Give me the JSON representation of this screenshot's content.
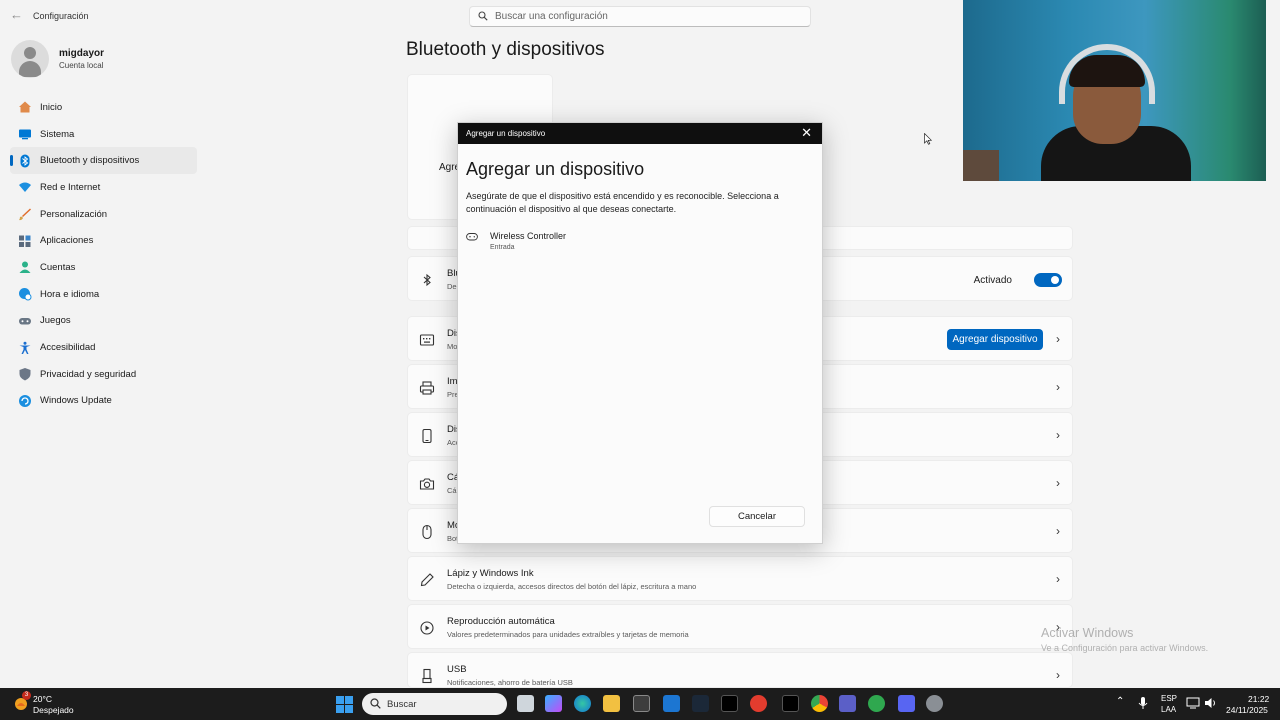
{
  "app": {
    "title": "Configuración",
    "search_placeholder": "Buscar una configuración"
  },
  "profile": {
    "name": "migdayor",
    "account_type": "Cuenta local"
  },
  "sidebar": {
    "items": [
      {
        "label": "Inicio",
        "icon": "home-icon",
        "color": "#d97a3a",
        "active": false
      },
      {
        "label": "Sistema",
        "icon": "system-icon",
        "color": "#0078d4",
        "active": false
      },
      {
        "label": "Bluetooth y dispositivos",
        "icon": "bluetooth-icon",
        "color": "#0078d4",
        "active": true
      },
      {
        "label": "Red e Internet",
        "icon": "wifi-icon",
        "color": "#1b8fe0",
        "active": false
      },
      {
        "label": "Personalización",
        "icon": "brush-icon",
        "color": "#e06c2b",
        "active": false
      },
      {
        "label": "Aplicaciones",
        "icon": "apps-icon",
        "color": "#5a6a7d",
        "active": false
      },
      {
        "label": "Cuentas",
        "icon": "account-icon",
        "color": "#2bb28a",
        "active": false
      },
      {
        "label": "Hora e idioma",
        "icon": "globe-clock-icon",
        "color": "#1b8fe0",
        "active": false
      },
      {
        "label": "Juegos",
        "icon": "gamepad-icon",
        "color": "#6a7785",
        "active": false
      },
      {
        "label": "Accesibilidad",
        "icon": "accessibility-icon",
        "color": "#1b6fd0",
        "active": false
      },
      {
        "label": "Privacidad y seguridad",
        "icon": "shield-icon",
        "color": "#6c7787",
        "active": false
      },
      {
        "label": "Windows Update",
        "icon": "update-icon",
        "color": "#1b8fe0",
        "active": false
      }
    ]
  },
  "main": {
    "page_title": "Bluetooth y dispositivos",
    "add_tile_label": "Agre",
    "rows": {
      "bluetooth": {
        "title": "Blu",
        "subtitle": "De",
        "toggle_label": "Activado",
        "toggle_on": true
      },
      "devices": {
        "title": "Dis",
        "subtitle": "Mo",
        "button_label": "Agregar dispositivo"
      },
      "printers": {
        "title": "Im",
        "subtitle": "Pre"
      },
      "phone": {
        "title": "Dis",
        "subtitle": "Acc"
      },
      "cameras": {
        "title": "Cá",
        "subtitle": "Cá"
      },
      "mouse": {
        "title": "Mo",
        "subtitle": "Bot"
      },
      "pen": {
        "title": "Lápiz y Windows Ink",
        "subtitle": "Detecha o izquierda, accesos directos del botón del lápiz, escritura a mano"
      },
      "autoplay": {
        "title": "Reproducción automática",
        "subtitle": "Valores predeterminados para unidades extraíbles y tarjetas de memoria"
      },
      "usb": {
        "title": "USB",
        "subtitle": "Notificaciones, ahorro de batería USB"
      }
    }
  },
  "dialog": {
    "window_title": "Agregar un dispositivo",
    "heading": "Agregar un dispositivo",
    "description": "Asegúrate de que el dispositivo está encendido y es reconocible. Selecciona a continuación el dispositivo al que deseas conectarte.",
    "devices": [
      {
        "name": "Wireless Controller",
        "type": "Entrada",
        "icon": "gamepad-icon"
      }
    ],
    "cancel_label": "Cancelar"
  },
  "watermark": {
    "line1": "Activar Windows",
    "line2": "Ve a Configuración para activar Windows."
  },
  "taskbar": {
    "weather_temp": "20°C",
    "weather_desc": "Despejado",
    "weather_badge": "3",
    "search_label": "Buscar",
    "lang_line1": "ESP",
    "lang_line2": "LAA",
    "time": "21:22",
    "date": "24/11/2025"
  }
}
